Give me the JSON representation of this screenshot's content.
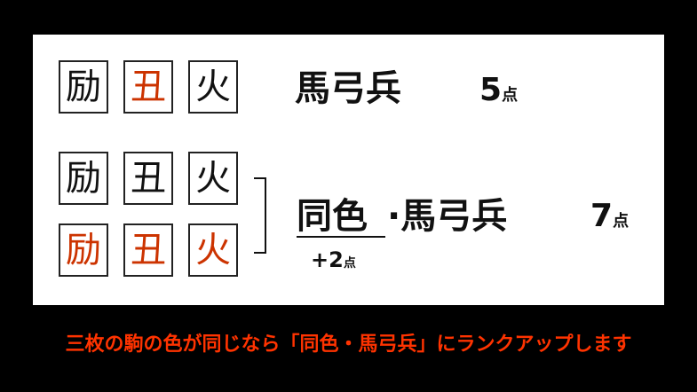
{
  "row1": {
    "tiles": [
      {
        "char": "励",
        "color": "#111111"
      },
      {
        "char": "丑",
        "color": "#cc3300"
      },
      {
        "char": "火",
        "color": "#111111"
      }
    ],
    "hand_name": "馬弓兵",
    "points_num": "5",
    "points_unit": "点"
  },
  "row2": {
    "tiles_top": [
      {
        "char": "励",
        "color": "#111111"
      },
      {
        "char": "丑",
        "color": "#111111"
      },
      {
        "char": "火",
        "color": "#111111"
      }
    ],
    "tiles_bottom": [
      {
        "char": "励",
        "color": "#cc3300"
      },
      {
        "char": "丑",
        "color": "#cc3300"
      },
      {
        "char": "火",
        "color": "#cc3300"
      }
    ],
    "prefix": "同色",
    "hand_name": "·馬弓兵",
    "bonus_num": "+2",
    "bonus_unit": "点",
    "points_num": "7",
    "points_unit": "点"
  },
  "caption": "三枚の駒の色が同じなら「同色・馬弓兵」にランクアップします",
  "colors": {
    "background": "#000000",
    "panel": "#ffffff",
    "red": "#cc3300",
    "caption": "#ff3300"
  }
}
